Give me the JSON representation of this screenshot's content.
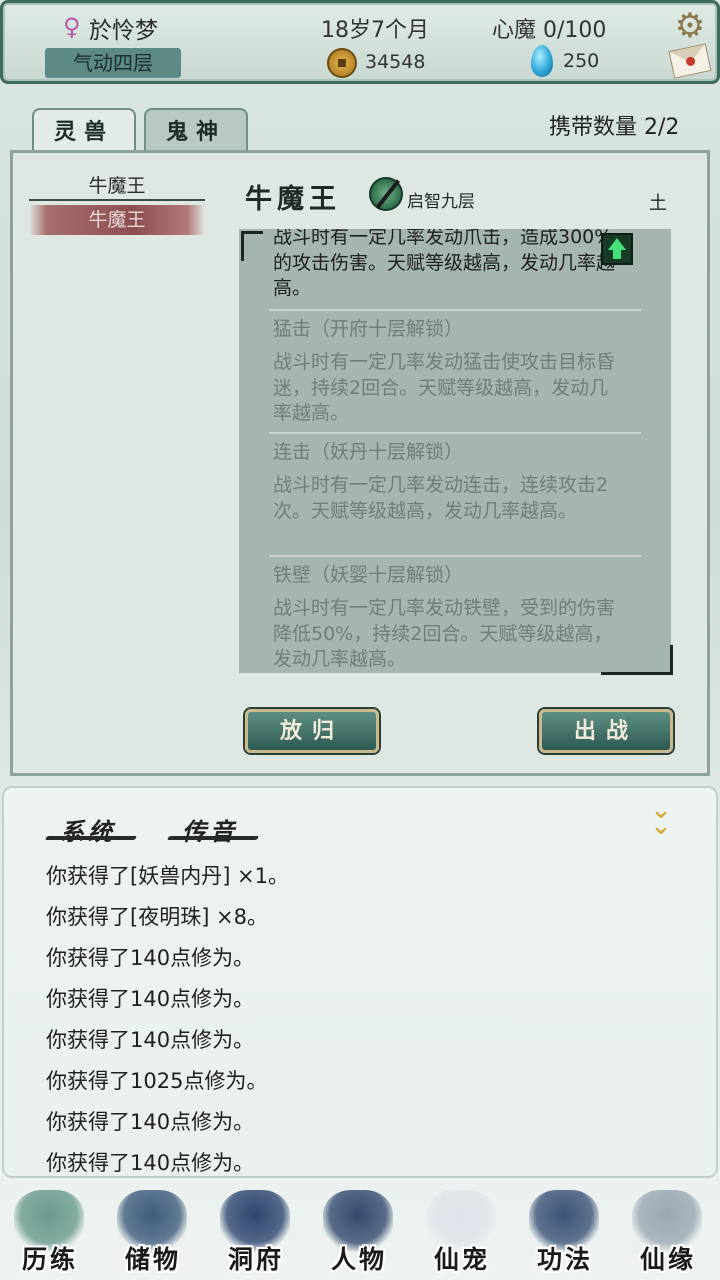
{
  "header": {
    "gender_icon": "female-icon",
    "player_name": "於怜梦",
    "realm": "气动四层",
    "age": "18岁7个月",
    "demon": "心魔  0/100",
    "coins": "34548",
    "gems": "250"
  },
  "tabs": [
    {
      "label": "灵兽"
    },
    {
      "label": "鬼神"
    }
  ],
  "carry": "携带数量   2/2",
  "pet_list": [
    "牛魔王",
    "牛魔王"
  ],
  "pet": {
    "name": "牛魔王",
    "level": "启智九层",
    "element": "土"
  },
  "talents": {
    "active_desc": "战斗时有一定几率发动爪击，造成300%的攻击伤害。天赋等级越高，发动几率越高。",
    "locked": [
      {
        "title": "猛击（开府十层解锁）",
        "desc": "战斗时有一定几率发动猛击使攻击目标昏迷，持续2回合。天赋等级越高，发动几率越高。"
      },
      {
        "title": "连击（妖丹十层解锁）",
        "desc": "战斗时有一定几率发动连击，连续攻击2次。天赋等级越高，发动几率越高。"
      },
      {
        "title": "铁壁（妖婴十层解锁）",
        "desc": "战斗时有一定几率发动铁壁，受到的伤害降低50%，持续2回合。天赋等级越高，发动几率越高。"
      }
    ]
  },
  "buttons": {
    "release": "放归",
    "battle": "出战"
  },
  "chat": {
    "tabs": [
      "系统",
      "传音"
    ],
    "lines": [
      "你获得了[妖兽内丹] ×1。",
      "你获得了[夜明珠] ×8。",
      "你获得了140点修为。",
      "你获得了140点修为。",
      "你获得了140点修为。",
      "你获得了1025点修为。",
      "你获得了140点修为。",
      "你获得了140点修为。"
    ]
  },
  "nav": [
    {
      "label": "历练",
      "icon": "training-icon",
      "color": "#6a9a8e"
    },
    {
      "label": "储物",
      "icon": "storage-icon",
      "color": "#3f5d7d"
    },
    {
      "label": "洞府",
      "icon": "cave-icon",
      "color": "#2f4670"
    },
    {
      "label": "人物",
      "icon": "character-icon",
      "color": "#354a6e"
    },
    {
      "label": "仙宠",
      "icon": "pet-icon",
      "color": "#dfe4ea"
    },
    {
      "label": "功法",
      "icon": "technique-icon",
      "color": "#3d5478"
    },
    {
      "label": "仙缘",
      "icon": "fate-icon",
      "color": "#9aa7b2"
    }
  ]
}
